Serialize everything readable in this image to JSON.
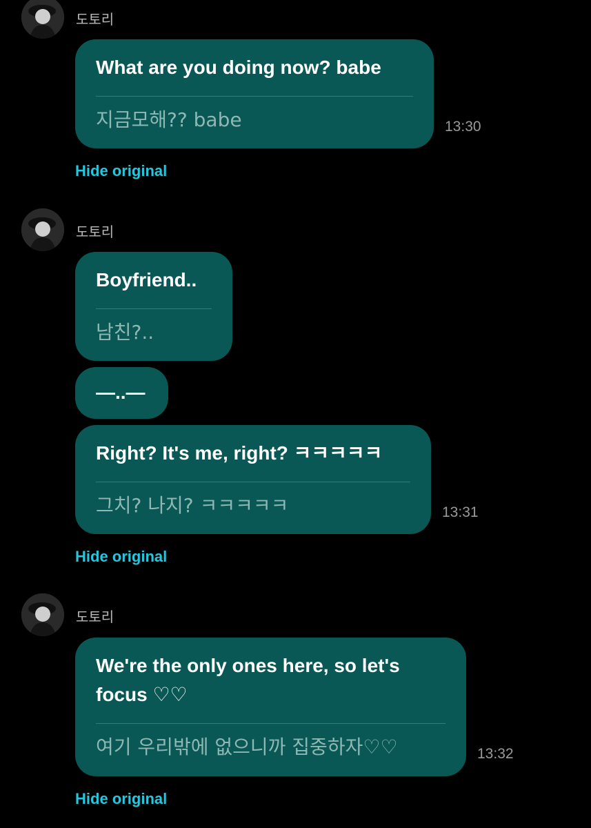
{
  "colors": {
    "background": "#000000",
    "bubble": "#0a5855",
    "link": "#28c6dc",
    "time": "#9a9a9a"
  },
  "messages": [
    {
      "sender": "도토리",
      "translated": "What are you doing now? babe",
      "original": "지금모해?? babe",
      "time": "13:30",
      "hide_label": "Hide original"
    },
    {
      "sender": "도토리",
      "translated": "Boyfriend..",
      "original": "남친?..",
      "time": "",
      "hide_label": ""
    },
    {
      "sender": "",
      "translated": "—..—",
      "original": "",
      "time": "",
      "hide_label": ""
    },
    {
      "sender": "",
      "translated": "Right? It's me, right? ㅋㅋㅋㅋㅋ",
      "original": "그치? 나지? ㅋㅋㅋㅋㅋ",
      "time": "13:31",
      "hide_label": "Hide original"
    },
    {
      "sender": "도토리",
      "translated": "We're the only ones here, so let's focus ♡♡",
      "original": "여기 우리밖에 없으니까 집중하자♡♡",
      "time": "13:32",
      "hide_label": "Hide original"
    }
  ]
}
